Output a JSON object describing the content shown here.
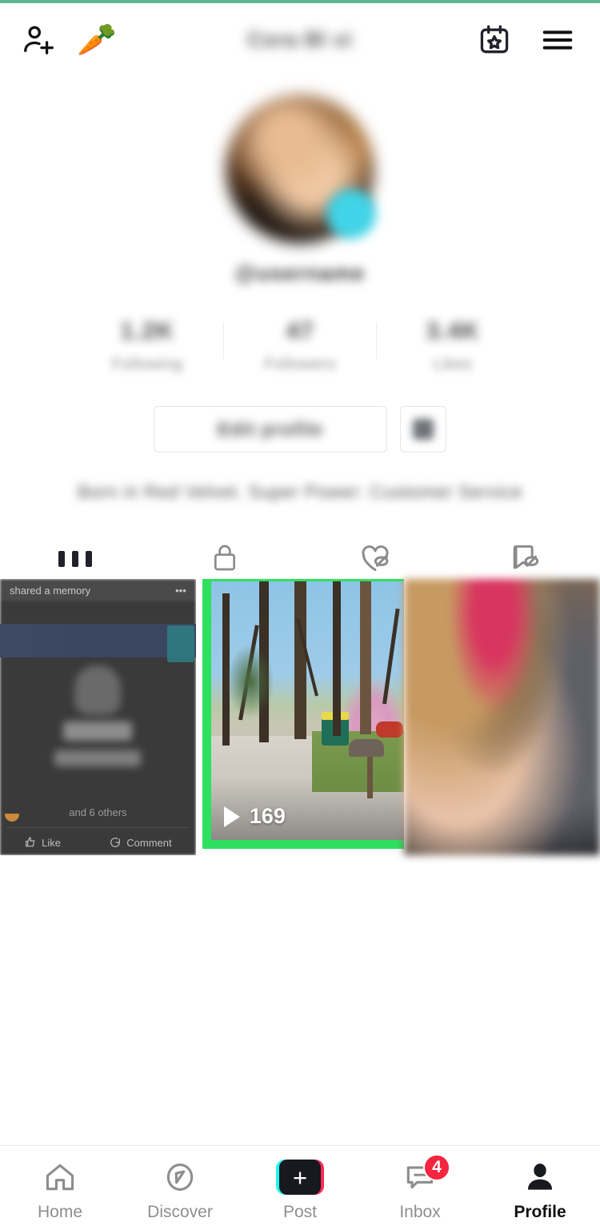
{
  "topbar": {
    "add_friend_icon": "person-add-icon",
    "carrot_icon": "🥕",
    "title": "Cora Bl xi",
    "calendar_icon": "calendar-star-icon",
    "menu_icon": "hamburger-menu-icon"
  },
  "profile": {
    "avatar_alt": "profile-avatar",
    "badge_alt": "verified-badge",
    "username": "@username",
    "stats": [
      {
        "value": "1.2K",
        "label": "Following"
      },
      {
        "value": "47",
        "label": "Followers"
      },
      {
        "value": "3.4K",
        "label": "Likes"
      }
    ],
    "edit_button": "Edit profile",
    "secondary_button_icon": "bookmark-icon",
    "bio": "Born in Red Velvet. Super Power: Customer Service"
  },
  "tabs": [
    {
      "name": "videos",
      "icon": "grid-icon",
      "active": true
    },
    {
      "name": "private",
      "icon": "lock-icon",
      "active": false
    },
    {
      "name": "liked",
      "icon": "heart-hidden-icon",
      "active": false
    },
    {
      "name": "favorites",
      "icon": "bookmark-hidden-icon",
      "active": false
    }
  ],
  "grid": {
    "highlight_color": "#2ee05f",
    "items": [
      {
        "name": "video-thumbnail-left",
        "type": "facebook-memory-screenshot",
        "highlighted": false,
        "overlay_texts": {
          "header": "shared a memory",
          "more": "•••",
          "others": "and 6 others",
          "like": "Like",
          "comment": "Comment"
        }
      },
      {
        "name": "video-thumbnail-center",
        "type": "outdoor-driveway-video",
        "highlighted": true,
        "play_count": "169",
        "play_icon": "play-icon"
      },
      {
        "name": "video-thumbnail-right",
        "type": "blurred-photo",
        "highlighted": false
      }
    ]
  },
  "bottom_nav": [
    {
      "label": "Home",
      "icon": "home-icon",
      "active": false,
      "badge": null
    },
    {
      "label": "Discover",
      "icon": "compass-icon",
      "active": false,
      "badge": null
    },
    {
      "label": "Post",
      "icon": "plus-icon",
      "active": false,
      "badge": null
    },
    {
      "label": "Inbox",
      "icon": "message-icon",
      "active": false,
      "badge": "4"
    },
    {
      "label": "Profile",
      "icon": "person-icon",
      "active": true,
      "badge": null
    }
  ],
  "colors": {
    "accent_green": "#2ee05f",
    "top_hairline": "#5fb894",
    "tiktok_cyan": "#25f4ee",
    "tiktok_pink": "#fe2c55",
    "badge_red": "#f5243f",
    "avatar_badge_cyan": "#41d4e8"
  }
}
